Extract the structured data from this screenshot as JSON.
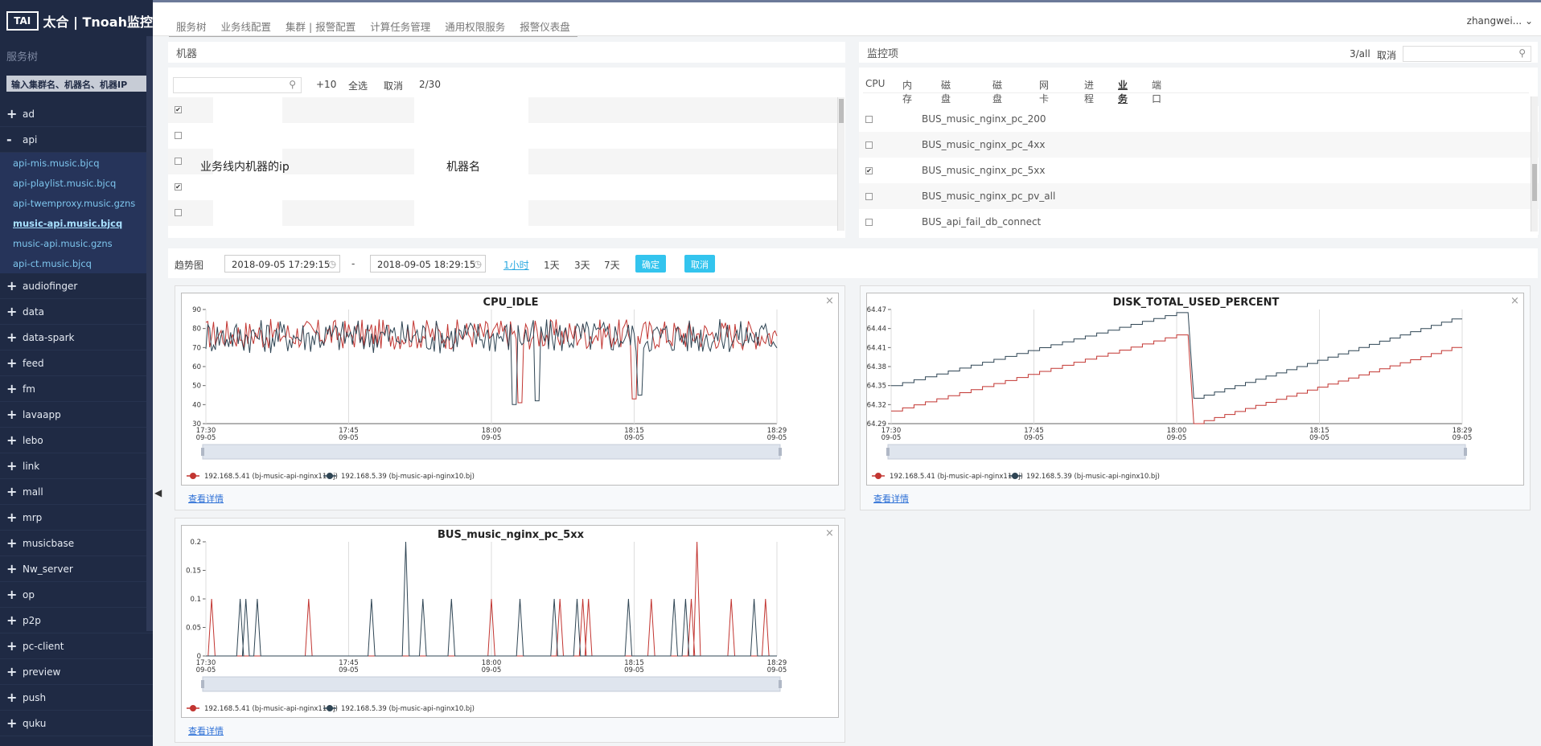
{
  "app": {
    "logo_mark": "TAI",
    "logo_text": "太合 | Tnoah监控"
  },
  "sidebar": {
    "title": "服务树",
    "search_placeholder": "输入集群名、机器名、机器IP",
    "items_before": [
      {
        "label": "ad",
        "toggle": "+"
      }
    ],
    "open_item": {
      "label": "api",
      "toggle": "-"
    },
    "sub_items": [
      {
        "label": "api-mis.music.bjcq"
      },
      {
        "label": "api-playlist.music.bjcq"
      },
      {
        "label": "api-twemproxy.music.gzns"
      },
      {
        "label": "music-api.music.bjcq"
      },
      {
        "label": "music-api.music.gzns"
      },
      {
        "label": "api-ct.music.bjcq"
      }
    ],
    "items_after": [
      {
        "label": "audiofinger"
      },
      {
        "label": "data"
      },
      {
        "label": "data-spark"
      },
      {
        "label": "feed"
      },
      {
        "label": "fm"
      },
      {
        "label": "lavaapp"
      },
      {
        "label": "lebo"
      },
      {
        "label": "link"
      },
      {
        "label": "mall"
      },
      {
        "label": "mrp"
      },
      {
        "label": "musicbase"
      },
      {
        "label": "Nw_server"
      },
      {
        "label": "op"
      },
      {
        "label": "p2p"
      },
      {
        "label": "pc-client"
      },
      {
        "label": "preview"
      },
      {
        "label": "push"
      },
      {
        "label": "quku"
      }
    ],
    "plus": "+",
    "collapse_glyph": "◀"
  },
  "topnav": {
    "tabs": [
      "服务树",
      "业务线配置",
      "集群 | 报警配置",
      "计算任务管理",
      "通用权限服务",
      "报警仪表盘"
    ],
    "user": "zhangwei..."
  },
  "machines": {
    "title": "机器",
    "plus10": "+10",
    "select_all": "全选",
    "cancel": "取消",
    "count": "2/30",
    "ip_label": "业务线内机器的ip",
    "name_label": "机器名",
    "rows": [
      {
        "checked": true
      },
      {
        "checked": false
      },
      {
        "checked": false
      },
      {
        "checked": true
      },
      {
        "checked": false
      }
    ]
  },
  "monitor": {
    "title": "监控项",
    "count": "3/all",
    "cancel": "取消",
    "tabs": [
      "CPU",
      "内存",
      "磁盘空间",
      "磁盘IO",
      "网卡IO",
      "进程",
      "业务",
      "端口"
    ],
    "active_tab": "业务",
    "rows": [
      {
        "label": "BUS_music_nginx_pc_200",
        "checked": false
      },
      {
        "label": "BUS_music_nginx_pc_4xx",
        "checked": false
      },
      {
        "label": "BUS_music_nginx_pc_5xx",
        "checked": true
      },
      {
        "label": "BUS_music_nginx_pc_pv_all",
        "checked": false
      },
      {
        "label": "BUS_api_fail_db_connect",
        "checked": false
      }
    ]
  },
  "trend": {
    "label": "趋势图",
    "start": "2018-09-05 17:29:15",
    "dash": "-",
    "end": "2018-09-05 18:29:15",
    "ranges": [
      "1小时",
      "1天",
      "3天",
      "7天"
    ],
    "active_range": "1小时",
    "confirm": "确定",
    "cancel": "取消"
  },
  "charts": {
    "close": "×",
    "detail": "查看详情",
    "legend": [
      "192.168.5.41 (bj-music-api-nginx11.bj)",
      "192.168.5.39 (bj-music-api-nginx10.bj)"
    ]
  },
  "colors": {
    "series_a": "#c23531",
    "series_b": "#2f4554",
    "accent": "#33c4ee",
    "sidebar": "#1f2a44"
  },
  "chart_data": [
    {
      "type": "line",
      "title": "CPU_IDLE",
      "x_ticks": [
        "17:30\n09-05",
        "17:45\n09-05",
        "18:00\n09-05",
        "18:15\n09-05",
        "18:29\n09-05"
      ],
      "ylim": [
        30,
        90
      ],
      "y_ticks": [
        30,
        40,
        50,
        60,
        70,
        80,
        90
      ],
      "series": [
        {
          "name": "192.168.5.41 (bj-music-api-nginx11.bj)",
          "pattern": "noise",
          "base": 77,
          "amp": 8,
          "dips": [
            [
              0.55,
              41
            ],
            [
              0.75,
              43
            ]
          ]
        },
        {
          "name": "192.168.5.39 (bj-music-api-nginx10.bj)",
          "pattern": "noise",
          "base": 76,
          "amp": 9,
          "dips": [
            [
              0.54,
              40
            ],
            [
              0.58,
              42
            ],
            [
              0.76,
              45
            ]
          ]
        }
      ]
    },
    {
      "type": "line",
      "title": "DISK_TOTAL_USED_PERCENT",
      "x_ticks": [
        "17:30\n09-05",
        "17:45\n09-05",
        "18:00\n09-05",
        "18:15\n09-05",
        "18:29\n09-05"
      ],
      "ylim": [
        64.29,
        64.47
      ],
      "y_ticks": [
        64.29,
        64.32,
        64.35,
        64.38,
        64.41,
        64.44,
        64.47
      ],
      "series": [
        {
          "name": "192.168.5.41 (bj-music-api-nginx11.bj)",
          "pattern": "stair",
          "segments": [
            [
              0.0,
              0.52,
              64.31,
              64.43
            ],
            [
              0.53,
              1.0,
              64.29,
              64.41
            ]
          ]
        },
        {
          "name": "192.168.5.39 (bj-music-api-nginx10.bj)",
          "pattern": "stair",
          "segments": [
            [
              0.0,
              0.52,
              64.35,
              64.465
            ],
            [
              0.53,
              1.0,
              64.33,
              64.455
            ]
          ]
        }
      ]
    },
    {
      "type": "line",
      "title": "BUS_music_nginx_pc_5xx",
      "x_ticks": [
        "17:30\n09-05",
        "17:45\n09-05",
        "18:00\n09-05",
        "18:15\n09-05",
        "18:29\n09-05"
      ],
      "ylim": [
        0,
        0.2
      ],
      "y_ticks": [
        0,
        0.05,
        0.1,
        0.15,
        0.2
      ],
      "series": [
        {
          "name": "192.168.5.41 (bj-music-api-nginx11.bj)",
          "pattern": "spikes",
          "spikes": [
            [
              0.01,
              0.1
            ],
            [
              0.18,
              0.1
            ],
            [
              0.5,
              0.1
            ],
            [
              0.62,
              0.1
            ],
            [
              0.66,
              0.1
            ],
            [
              0.67,
              0.1
            ],
            [
              0.78,
              0.1
            ],
            [
              0.85,
              0.1
            ],
            [
              0.86,
              0.2
            ],
            [
              0.92,
              0.1
            ],
            [
              0.98,
              0.1
            ]
          ]
        },
        {
          "name": "192.168.5.39 (bj-music-api-nginx10.bj)",
          "pattern": "spikes",
          "spikes": [
            [
              0.06,
              0.1
            ],
            [
              0.07,
              0.1
            ],
            [
              0.09,
              0.1
            ],
            [
              0.29,
              0.1
            ],
            [
              0.35,
              0.2
            ],
            [
              0.38,
              0.1
            ],
            [
              0.43,
              0.1
            ],
            [
              0.55,
              0.1
            ],
            [
              0.61,
              0.1
            ],
            [
              0.65,
              0.1
            ],
            [
              0.74,
              0.1
            ],
            [
              0.82,
              0.1
            ],
            [
              0.84,
              0.1
            ],
            [
              0.96,
              0.1
            ]
          ]
        }
      ]
    }
  ]
}
